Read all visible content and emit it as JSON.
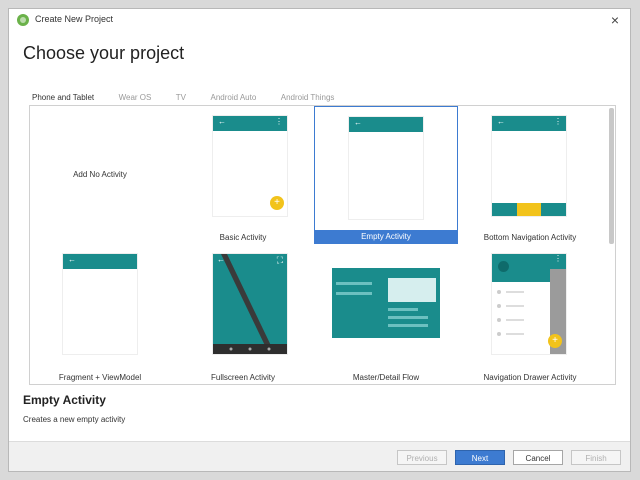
{
  "window": {
    "title": "Create New Project",
    "close_glyph": "×"
  },
  "header": {
    "title": "Choose your project"
  },
  "tabs": [
    {
      "label": "Phone and Tablet",
      "active": true
    },
    {
      "label": "Wear OS",
      "active": false
    },
    {
      "label": "TV",
      "active": false
    },
    {
      "label": "Android Auto",
      "active": false
    },
    {
      "label": "Android Things",
      "active": false
    }
  ],
  "templates": [
    {
      "label": "Add No Activity"
    },
    {
      "label": "Basic Activity"
    },
    {
      "label": "Empty Activity",
      "selected": true
    },
    {
      "label": "Bottom Navigation Activity"
    },
    {
      "label": "Fragment + ViewModel"
    },
    {
      "label": "Fullscreen Activity"
    },
    {
      "label": "Master/Detail Flow"
    },
    {
      "label": "Navigation Drawer Activity"
    }
  ],
  "glyphs": {
    "back_arrow": "←",
    "more_dots": "⋮",
    "plus": "+",
    "expand": "⛶"
  },
  "selection": {
    "title": "Empty Activity",
    "description": "Creates a new empty activity"
  },
  "footer": {
    "previous_label": "Previous",
    "next_label": "Next",
    "cancel_label": "Cancel",
    "finish_label": "Finish"
  },
  "colors": {
    "accent": "#3d7bd1",
    "teal": "#1a8c8c",
    "fab": "#f2c31b"
  }
}
